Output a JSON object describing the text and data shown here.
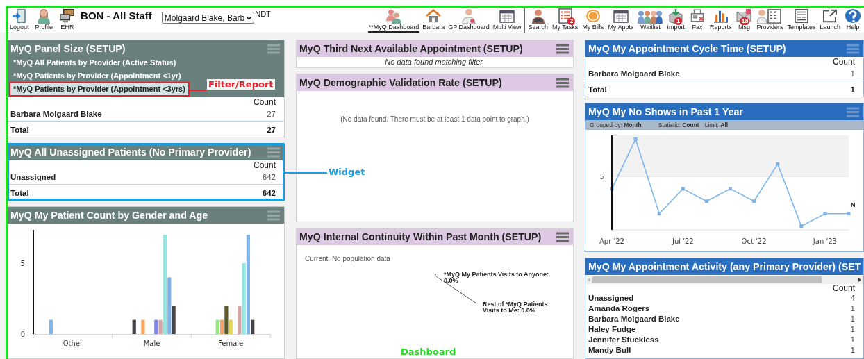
{
  "toolbar": {
    "left_items": [
      {
        "label": "Logout"
      },
      {
        "label": "Profile"
      },
      {
        "label": "EHR"
      }
    ],
    "title": "BON - All Staff",
    "provider_select": {
      "value": "Molgaard Blake, Barb"
    },
    "site_code": "NDT",
    "dashboard_tabs": [
      {
        "label": "**MyQ Dashboard",
        "selected": true
      },
      {
        "label": "Barbara",
        "selected": false
      },
      {
        "label": "GP Dashboard",
        "selected": false
      },
      {
        "label": "Multi View",
        "selected": false
      }
    ],
    "tools": [
      {
        "label": "Search"
      },
      {
        "label": "My Tasks",
        "badge": "2"
      },
      {
        "label": "My Bills"
      },
      {
        "label": "My Appts"
      },
      {
        "label": "Waitlist"
      },
      {
        "label": "Import",
        "badge": "1"
      },
      {
        "label": "Fax"
      },
      {
        "label": "Reports"
      },
      {
        "label": "Msg",
        "badge": "18"
      },
      {
        "label": "Providers"
      },
      {
        "label": "Templates"
      },
      {
        "label": "Launch"
      },
      {
        "label": "Help"
      }
    ]
  },
  "columns": [
    {
      "widgets": [
        {
          "kind": "table",
          "title": "MyQ Panel Size (SETUP)",
          "color": "#6a807d",
          "filters": [
            {
              "label": "*MyQ All Patients by Provider (Active Status)",
              "selected": false
            },
            {
              "label": "*MyQ Patients by Provider (Appointment <1yr)",
              "selected": false
            },
            {
              "label": "*MyQ Patients by Provider (Appointment <3yrs)",
              "selected": true,
              "callout": {
                "label": "Filter/Report",
                "color": "#e0202a"
              }
            }
          ],
          "count_header": "Count",
          "rows": [
            {
              "name": "Barbara Molgaard Blake",
              "count": "27"
            }
          ],
          "total": {
            "label": "Total",
            "count": "27"
          }
        },
        {
          "kind": "table",
          "title": "MyQ All Unassigned Patients (No Primary Provider)",
          "color": "#6a807d",
          "callout": {
            "label": "Widget",
            "color": "#1aa0e0"
          },
          "count_header": "Count",
          "rows": [
            {
              "name": "Unassigned",
              "count": "642"
            }
          ],
          "total": {
            "label": "Total",
            "count": "642"
          }
        },
        {
          "kind": "bar-chart",
          "title": "MyQ My Patient Count by Gender and Age",
          "color": "#6a807d",
          "chart_data": {
            "type": "bar",
            "categories": [
              "Other",
              "Male",
              "Female"
            ],
            "ylim": [
              0,
              7.35
            ],
            "yticks": [
              0,
              5
            ],
            "series": [
              {
                "color": "#7cb5ec",
                "values": [
                  1,
                  null,
                  null
                ]
              },
              {
                "color": "#434348",
                "values": [
                  null,
                  1,
                  null
                ]
              },
              {
                "color": "#90ed7d",
                "values": [
                  null,
                  null,
                  1
                ]
              },
              {
                "color": "#f7a35c",
                "values": [
                  null,
                  1,
                  1
                ]
              },
              {
                "color": "#5b5b25",
                "values": [
                  null,
                  null,
                  2
                ]
              },
              {
                "color": "#e4d354",
                "values": [
                  null,
                  null,
                  1
                ]
              },
              {
                "color": "#8085e9",
                "values": [
                  null,
                  1,
                  null
                ]
              },
              {
                "color": "#d4a5a5",
                "values": [
                  null,
                  1,
                  2
                ]
              },
              {
                "color": "#91e8e1",
                "values": [
                  null,
                  7,
                  5
                ]
              },
              {
                "color": "#7cb5ec",
                "values": [
                  null,
                  4,
                  7
                ]
              },
              {
                "color": "#434348",
                "values": [
                  null,
                  2,
                  1
                ]
              }
            ]
          }
        }
      ]
    },
    {
      "widgets": [
        {
          "kind": "notice",
          "title": "MyQ Third Next Available Appointment (SETUP)",
          "color": "#dcc8e2",
          "message": "No data found matching filter."
        },
        {
          "kind": "empty-graph",
          "title": "MyQ Demographic Validation Rate (SETUP)",
          "color": "#dcc8e2",
          "message": "(No data found. There must be at least 1 data point to graph.)"
        },
        {
          "kind": "pie-labels",
          "title": "MyQ Internal Continuity Within Past Month (SETUP)",
          "color": "#dcc8e2",
          "current": "Current: No population data",
          "slice_labels": [
            "*MyQ My Patients Visits to Anyone: 0.0%",
            "Rest of *MyQ Patients Visits to Me: 0.0%"
          ]
        }
      ]
    },
    {
      "widgets": [
        {
          "kind": "table",
          "title": "MyQ My Appointment Cycle Time (SETUP)",
          "color": "#2a6ebf",
          "count_header": "Count",
          "rows": [
            {
              "name": "Barbara Molgaard Blake",
              "count": "1"
            }
          ],
          "total": {
            "label": "Total",
            "count": "1"
          }
        },
        {
          "kind": "line-chart",
          "title": "MyQ My No Shows in Past 1 Year",
          "color": "#2a6ebf",
          "settings": [
            {
              "label": "Grouped by:",
              "value": "Month"
            },
            {
              "label": "Statistic:",
              "value": "Count"
            },
            {
              "label": "Limit:",
              "value": "All"
            }
          ],
          "graph": {
            "x_labels": [
              "Apr '22",
              "Jul '22",
              "Oct '22",
              "Jan '23"
            ],
            "y_label": "5",
            "end_label": "N"
          }
        },
        {
          "kind": "scroll-table",
          "title": "MyQ My Appointment Activity (any Primary Provider) (SET",
          "color": "#2a6ebf",
          "count_header": "Count",
          "rows": [
            {
              "name": "Unassigned",
              "count": "4"
            },
            {
              "name": "Amanda Rogers",
              "count": "1"
            },
            {
              "name": "Barbara Molgaard Blake",
              "count": "1"
            },
            {
              "name": "Haley Fudge",
              "count": "1"
            },
            {
              "name": "Jennifer Stuckless",
              "count": "1"
            },
            {
              "name": "Mandy Bull",
              "count": "1"
            }
          ]
        }
      ]
    }
  ],
  "dashboard_callout": {
    "label": "Dashboard",
    "color": "#22dd22"
  }
}
